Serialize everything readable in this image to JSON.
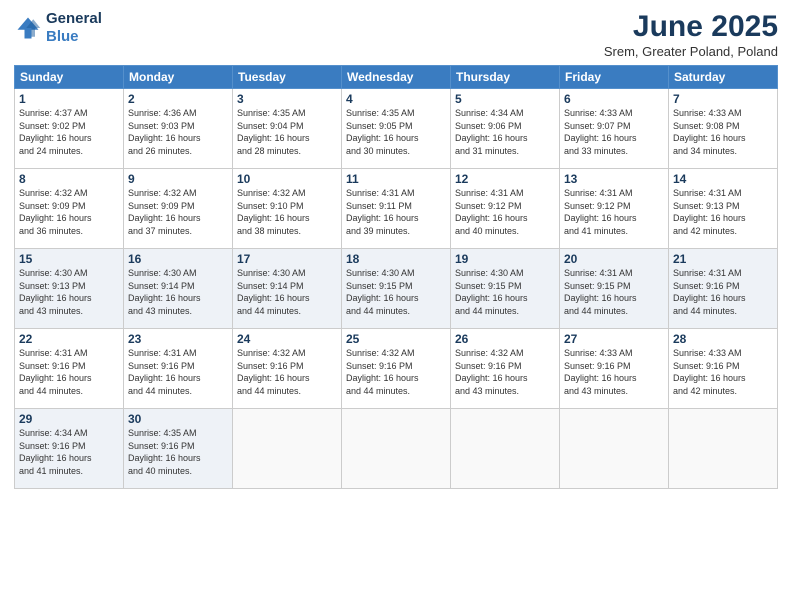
{
  "logo": {
    "line1": "General",
    "line2": "Blue"
  },
  "header": {
    "title": "June 2025",
    "subtitle": "Srem, Greater Poland, Poland"
  },
  "weekdays": [
    "Sunday",
    "Monday",
    "Tuesday",
    "Wednesday",
    "Thursday",
    "Friday",
    "Saturday"
  ],
  "weeks": [
    [
      {
        "day": "1",
        "info": "Sunrise: 4:37 AM\nSunset: 9:02 PM\nDaylight: 16 hours\nand 24 minutes."
      },
      {
        "day": "2",
        "info": "Sunrise: 4:36 AM\nSunset: 9:03 PM\nDaylight: 16 hours\nand 26 minutes."
      },
      {
        "day": "3",
        "info": "Sunrise: 4:35 AM\nSunset: 9:04 PM\nDaylight: 16 hours\nand 28 minutes."
      },
      {
        "day": "4",
        "info": "Sunrise: 4:35 AM\nSunset: 9:05 PM\nDaylight: 16 hours\nand 30 minutes."
      },
      {
        "day": "5",
        "info": "Sunrise: 4:34 AM\nSunset: 9:06 PM\nDaylight: 16 hours\nand 31 minutes."
      },
      {
        "day": "6",
        "info": "Sunrise: 4:33 AM\nSunset: 9:07 PM\nDaylight: 16 hours\nand 33 minutes."
      },
      {
        "day": "7",
        "info": "Sunrise: 4:33 AM\nSunset: 9:08 PM\nDaylight: 16 hours\nand 34 minutes."
      }
    ],
    [
      {
        "day": "8",
        "info": "Sunrise: 4:32 AM\nSunset: 9:09 PM\nDaylight: 16 hours\nand 36 minutes."
      },
      {
        "day": "9",
        "info": "Sunrise: 4:32 AM\nSunset: 9:09 PM\nDaylight: 16 hours\nand 37 minutes."
      },
      {
        "day": "10",
        "info": "Sunrise: 4:32 AM\nSunset: 9:10 PM\nDaylight: 16 hours\nand 38 minutes."
      },
      {
        "day": "11",
        "info": "Sunrise: 4:31 AM\nSunset: 9:11 PM\nDaylight: 16 hours\nand 39 minutes."
      },
      {
        "day": "12",
        "info": "Sunrise: 4:31 AM\nSunset: 9:12 PM\nDaylight: 16 hours\nand 40 minutes."
      },
      {
        "day": "13",
        "info": "Sunrise: 4:31 AM\nSunset: 9:12 PM\nDaylight: 16 hours\nand 41 minutes."
      },
      {
        "day": "14",
        "info": "Sunrise: 4:31 AM\nSunset: 9:13 PM\nDaylight: 16 hours\nand 42 minutes."
      }
    ],
    [
      {
        "day": "15",
        "info": "Sunrise: 4:30 AM\nSunset: 9:13 PM\nDaylight: 16 hours\nand 43 minutes."
      },
      {
        "day": "16",
        "info": "Sunrise: 4:30 AM\nSunset: 9:14 PM\nDaylight: 16 hours\nand 43 minutes."
      },
      {
        "day": "17",
        "info": "Sunrise: 4:30 AM\nSunset: 9:14 PM\nDaylight: 16 hours\nand 44 minutes."
      },
      {
        "day": "18",
        "info": "Sunrise: 4:30 AM\nSunset: 9:15 PM\nDaylight: 16 hours\nand 44 minutes."
      },
      {
        "day": "19",
        "info": "Sunrise: 4:30 AM\nSunset: 9:15 PM\nDaylight: 16 hours\nand 44 minutes."
      },
      {
        "day": "20",
        "info": "Sunrise: 4:31 AM\nSunset: 9:15 PM\nDaylight: 16 hours\nand 44 minutes."
      },
      {
        "day": "21",
        "info": "Sunrise: 4:31 AM\nSunset: 9:16 PM\nDaylight: 16 hours\nand 44 minutes."
      }
    ],
    [
      {
        "day": "22",
        "info": "Sunrise: 4:31 AM\nSunset: 9:16 PM\nDaylight: 16 hours\nand 44 minutes."
      },
      {
        "day": "23",
        "info": "Sunrise: 4:31 AM\nSunset: 9:16 PM\nDaylight: 16 hours\nand 44 minutes."
      },
      {
        "day": "24",
        "info": "Sunrise: 4:32 AM\nSunset: 9:16 PM\nDaylight: 16 hours\nand 44 minutes."
      },
      {
        "day": "25",
        "info": "Sunrise: 4:32 AM\nSunset: 9:16 PM\nDaylight: 16 hours\nand 44 minutes."
      },
      {
        "day": "26",
        "info": "Sunrise: 4:32 AM\nSunset: 9:16 PM\nDaylight: 16 hours\nand 43 minutes."
      },
      {
        "day": "27",
        "info": "Sunrise: 4:33 AM\nSunset: 9:16 PM\nDaylight: 16 hours\nand 43 minutes."
      },
      {
        "day": "28",
        "info": "Sunrise: 4:33 AM\nSunset: 9:16 PM\nDaylight: 16 hours\nand 42 minutes."
      }
    ],
    [
      {
        "day": "29",
        "info": "Sunrise: 4:34 AM\nSunset: 9:16 PM\nDaylight: 16 hours\nand 41 minutes."
      },
      {
        "day": "30",
        "info": "Sunrise: 4:35 AM\nSunset: 9:16 PM\nDaylight: 16 hours\nand 40 minutes."
      },
      null,
      null,
      null,
      null,
      null
    ]
  ]
}
